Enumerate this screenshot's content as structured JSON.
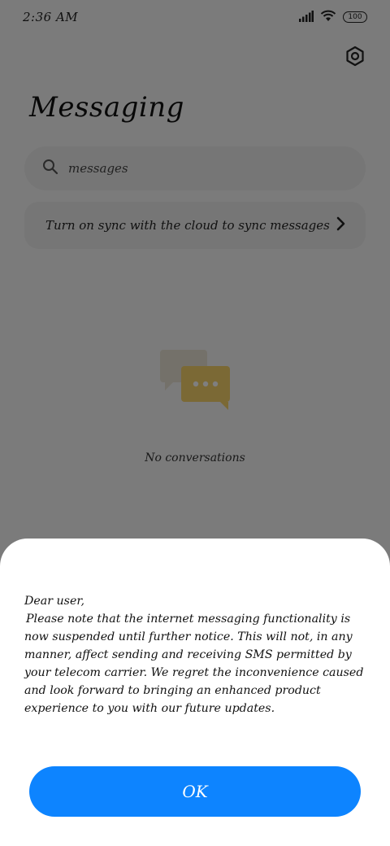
{
  "status_bar": {
    "time": "2:36 AM",
    "battery": "100",
    "icons": [
      "signal-icon",
      "wifi-icon",
      "battery-icon"
    ]
  },
  "header": {
    "title": "Messaging",
    "settings_icon": "gear-icon"
  },
  "search": {
    "placeholder": "messages",
    "cursor_char": "I"
  },
  "sync_banner": {
    "text": "Turn on sync with the cloud to sync messages",
    "icon": "chevron-right-icon"
  },
  "empty_state": {
    "text": "No conversations",
    "icon": "chat-bubbles-icon"
  },
  "dialog": {
    "greeting": "Dear user,",
    "body": "Please note that the internet messaging functionality is now suspended until further notice. This will not, in any manner, affect sending and receiving SMS permitted by your telecom carrier. We regret the inconvenience caused and look forward to bringing an enhanced product experience to you with our future updates.",
    "ok_label": "OK"
  },
  "colors": {
    "accent": "#0d84ff",
    "background": "#f6f6f6",
    "card": "#ececec",
    "bubble_yellow": "#f6d26a"
  }
}
